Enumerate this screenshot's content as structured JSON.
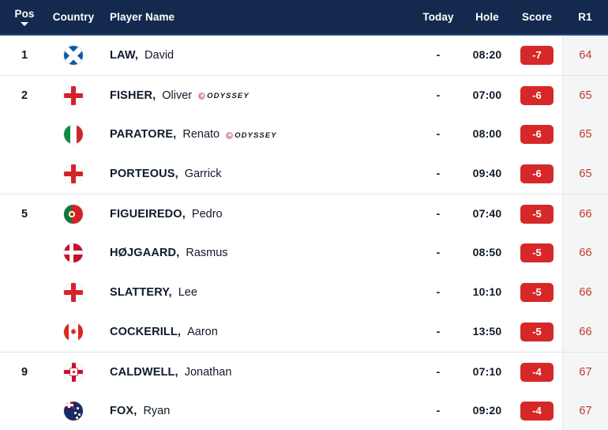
{
  "colors": {
    "header_bg": "#132a4e",
    "header_text": "#ffffff",
    "score_badge_bg": "#d62828",
    "r1_bg": "#f4f5f6",
    "r1_text": "#c0392b",
    "row_text": "#101a2c",
    "divider": "#e2e4e8"
  },
  "header": {
    "pos": "Pos",
    "country": "Country",
    "player_name": "Player Name",
    "today": "Today",
    "hole": "Hole",
    "score": "Score",
    "r1": "R1",
    "sort_indicator": "caret-down-icon"
  },
  "rows": [
    {
      "pos": "1",
      "group_start": true,
      "flag": "scotland",
      "flag_name": "flag-scotland",
      "surname": "LAW,",
      "first": "David",
      "sponsor": "",
      "today": "-",
      "hole": "08:20",
      "score": "-7",
      "r1": "64"
    },
    {
      "pos": "2",
      "group_start": true,
      "flag": "england",
      "flag_name": "flag-england",
      "surname": "FISHER,",
      "first": "Oliver",
      "sponsor": "ODYSSEY",
      "today": "-",
      "hole": "07:00",
      "score": "-6",
      "r1": "65"
    },
    {
      "pos": "",
      "group_start": false,
      "flag": "italy",
      "flag_name": "flag-italy",
      "surname": "PARATORE,",
      "first": "Renato",
      "sponsor": "ODYSSEY",
      "today": "-",
      "hole": "08:00",
      "score": "-6",
      "r1": "65"
    },
    {
      "pos": "",
      "group_start": false,
      "flag": "england",
      "flag_name": "flag-england",
      "surname": "PORTEOUS,",
      "first": "Garrick",
      "sponsor": "",
      "today": "-",
      "hole": "09:40",
      "score": "-6",
      "r1": "65"
    },
    {
      "pos": "5",
      "group_start": true,
      "flag": "portugal",
      "flag_name": "flag-portugal",
      "surname": "FIGUEIREDO,",
      "first": "Pedro",
      "sponsor": "",
      "today": "-",
      "hole": "07:40",
      "score": "-5",
      "r1": "66"
    },
    {
      "pos": "",
      "group_start": false,
      "flag": "denmark",
      "flag_name": "flag-denmark",
      "surname": "HØJGAARD,",
      "first": "Rasmus",
      "sponsor": "",
      "today": "-",
      "hole": "08:50",
      "score": "-5",
      "r1": "66"
    },
    {
      "pos": "",
      "group_start": false,
      "flag": "england",
      "flag_name": "flag-england",
      "surname": "SLATTERY,",
      "first": "Lee",
      "sponsor": "",
      "today": "-",
      "hole": "10:10",
      "score": "-5",
      "r1": "66"
    },
    {
      "pos": "",
      "group_start": false,
      "flag": "canada",
      "flag_name": "flag-canada",
      "surname": "COCKERILL,",
      "first": "Aaron",
      "sponsor": "",
      "today": "-",
      "hole": "13:50",
      "score": "-5",
      "r1": "66"
    },
    {
      "pos": "9",
      "group_start": true,
      "flag": "nireland",
      "flag_name": "flag-northern-ireland",
      "surname": "CALDWELL,",
      "first": "Jonathan",
      "sponsor": "",
      "today": "-",
      "hole": "07:10",
      "score": "-4",
      "r1": "67"
    },
    {
      "pos": "",
      "group_start": false,
      "flag": "nz",
      "flag_name": "flag-new-zealand",
      "surname": "FOX,",
      "first": "Ryan",
      "sponsor": "",
      "today": "-",
      "hole": "09:20",
      "score": "-4",
      "r1": "67"
    }
  ]
}
